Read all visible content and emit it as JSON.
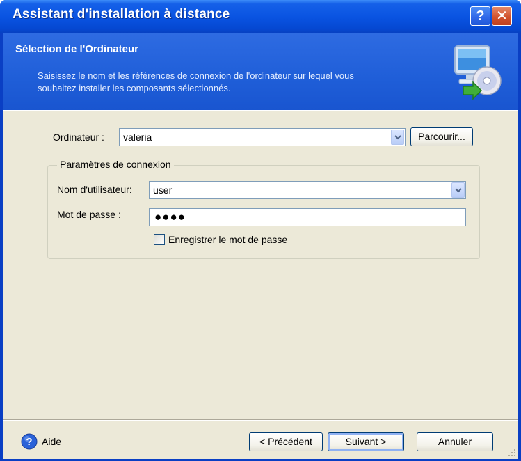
{
  "window": {
    "title": "Assistant d'installation à distance",
    "help_glyph": "?",
    "close_glyph": "✕"
  },
  "header": {
    "title": "Sélection de l'Ordinateur",
    "description_line1": "Saisissez le nom et les références de connexion de l'ordinateur sur lequel vous",
    "description_line2": "souhaitez installer les composants sélectionnés.",
    "icon": "computer-disc-icon"
  },
  "form": {
    "computer_label": "Ordinateur :",
    "computer_value": "valeria",
    "browse_button": "Parcourir...",
    "group_title": "Paramètres de connexion",
    "username_label": "Nom d'utilisateur:",
    "username_value": "user",
    "password_label": "Mot de passe :",
    "password_value": "●●●●",
    "save_password_label": "Enregistrer le mot de passe",
    "save_password_checked": false
  },
  "footer": {
    "help_label": "Aide",
    "back_button": "< Précédent",
    "next_button": "Suivant >",
    "cancel_button": "Annuler"
  },
  "colors": {
    "titlebar": "#0a54e2",
    "banner": "#1f5ed8",
    "dialog_bg": "#ece9d8",
    "close_button": "#d2532e"
  }
}
